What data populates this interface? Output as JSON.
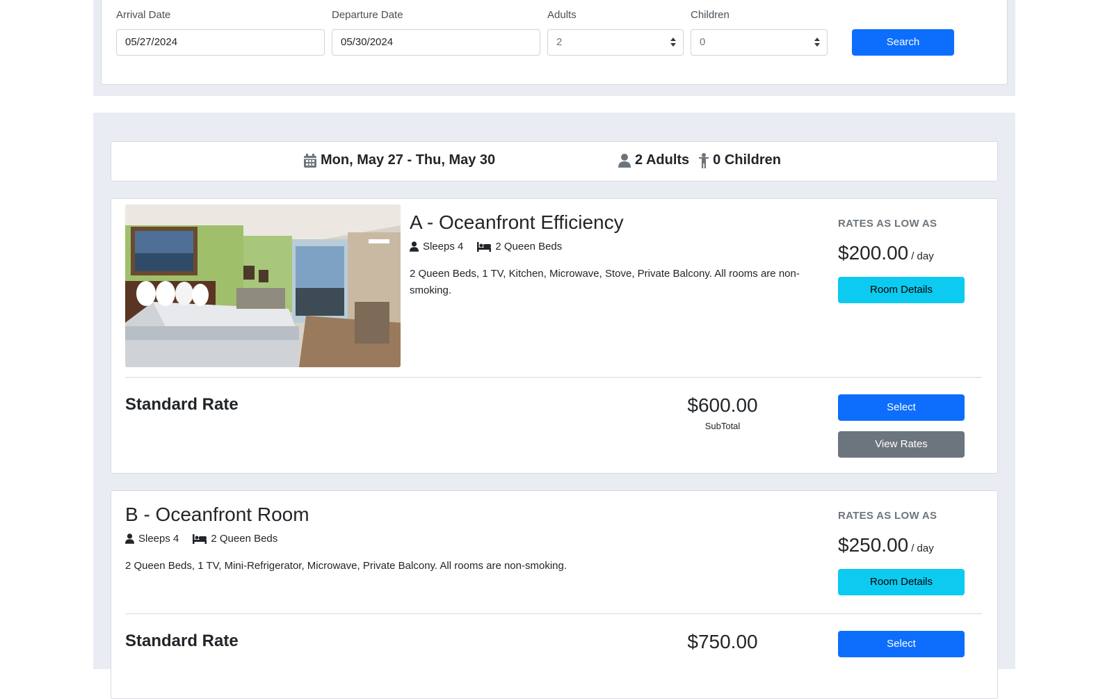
{
  "search": {
    "arrival_label": "Arrival Date",
    "arrival_value": "05/27/2024",
    "departure_label": "Departure Date",
    "departure_value": "05/30/2024",
    "adults_label": "Adults",
    "adults_value": "2",
    "children_label": "Children",
    "children_value": "0",
    "search_button": "Search"
  },
  "summary": {
    "dates": "Mon, May 27 - Thu, May 30",
    "adults": "2 Adults",
    "children": "0 Children"
  },
  "rooms": [
    {
      "title": "A - Oceanfront Efficiency",
      "sleeps": "Sleeps 4",
      "beds": "2 Queen Beds",
      "description": "2 Queen Beds, 1 TV, Kitchen, Microwave, Stove, Private Balcony. All rooms are non-smoking.",
      "rates_label": "RATES AS LOW AS",
      "price": "$200.00",
      "per": "/ day",
      "details_button": "Room Details",
      "rate_name": "Standard Rate",
      "subtotal": "$600.00",
      "subtotal_label": "SubTotal",
      "select_button": "Select",
      "view_rates_button": "View Rates"
    },
    {
      "title": "B - Oceanfront Room",
      "sleeps": "Sleeps 4",
      "beds": "2 Queen Beds",
      "description": "2 Queen Beds, 1 TV, Mini-Refrigerator, Microwave, Private Balcony. All rooms are non-smoking.",
      "rates_label": "RATES AS LOW AS",
      "price": "$250.00",
      "per": "/ day",
      "details_button": "Room Details",
      "rate_name": "Standard Rate",
      "subtotal": "$750.00",
      "select_button": "Select"
    }
  ],
  "colors": {
    "primary": "#0d6efd",
    "info": "#0dcaf0",
    "secondary": "#6c757d",
    "page_bg": "#e9ecf3"
  }
}
